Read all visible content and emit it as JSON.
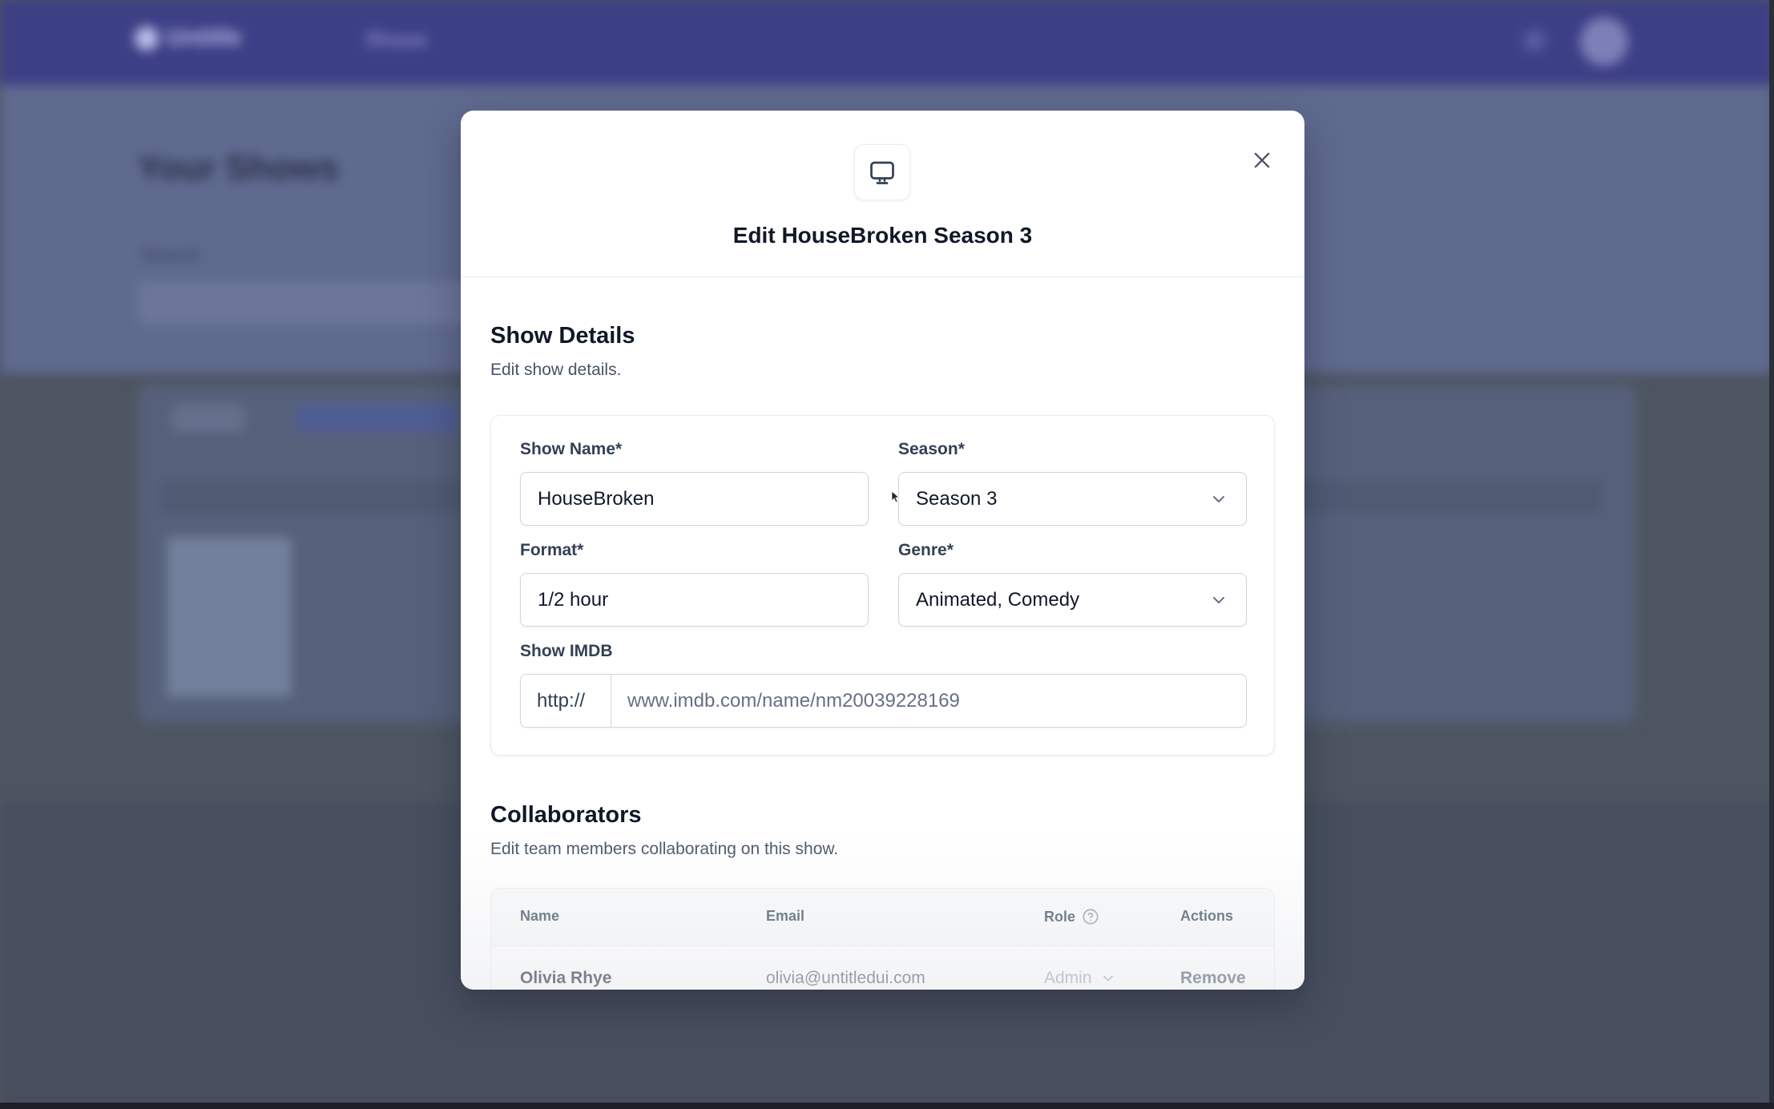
{
  "background": {
    "app_name": "Untitle",
    "nav_label": "Shows",
    "page_title": "Your Shows",
    "search_label": "Search"
  },
  "modal": {
    "icon": "tv-icon",
    "title": "Edit HouseBroken Season 3",
    "close_icon": "close-icon"
  },
  "show_details": {
    "title": "Show Details",
    "subtitle": "Edit show details.",
    "show_name": {
      "label": "Show Name*",
      "value": "HouseBroken"
    },
    "season": {
      "label": "Season*",
      "value": "Season 3"
    },
    "format": {
      "label": "Format*",
      "value": "1/2 hour"
    },
    "genre": {
      "label": "Genre*",
      "value": "Animated, Comedy"
    },
    "imdb": {
      "label": "Show IMDB",
      "prefix": "http://",
      "placeholder": "www.imdb.com/name/nm20039228169"
    }
  },
  "collaborators": {
    "title": "Collaborators",
    "subtitle": "Edit team members collaborating on this show.",
    "columns": {
      "name": "Name",
      "email": "Email",
      "role": "Role",
      "actions": "Actions"
    },
    "rows": [
      {
        "name": "Olivia Rhye",
        "email": "olivia@untitledui.com",
        "role": "Admin",
        "action": "Remove"
      }
    ]
  },
  "colors": {
    "topbar": "#3d3f86",
    "text_primary": "#101828",
    "text_secondary": "#475467",
    "border": "#d0d5dd"
  }
}
